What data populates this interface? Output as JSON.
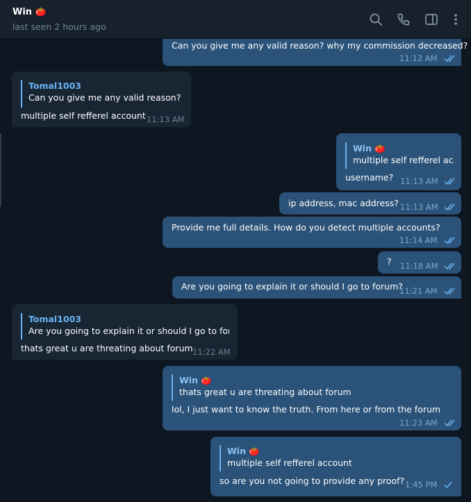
{
  "header": {
    "name": "Win 🍅",
    "status": "last seen 2 hours ago",
    "icons": [
      "search-icon",
      "phone-icon",
      "sidebar-toggle-icon",
      "more-vert-icon"
    ]
  },
  "colors": {
    "background": "#0e1621",
    "header": "#17212b",
    "outgoing_bubble": "#2b5278",
    "incoming_bubble": "#182533",
    "accent": "#6ab3f3"
  },
  "messages": [
    {
      "direction": "out",
      "text": "Can you give me any valid reason? why my commission decreased?",
      "time": "11:12 AM",
      "status": "read"
    },
    {
      "direction": "in",
      "reply": {
        "name": "Tomal1003",
        "text": "Can you give me any valid reason? ..."
      },
      "text": "multiple self refferel account",
      "time": "11:13 AM"
    },
    {
      "direction": "out",
      "reply": {
        "name": "Win 🍅",
        "text": "multiple self refferel ac..."
      },
      "text": "username?",
      "time": "11:13 AM",
      "status": "read"
    },
    {
      "direction": "out",
      "text": "ip address, mac address?",
      "time": "11:13 AM",
      "status": "read"
    },
    {
      "direction": "out",
      "text": "Provide me full details. How do you detect multiple accounts?",
      "time": "11:14 AM",
      "status": "read"
    },
    {
      "direction": "out",
      "text": "?",
      "time": "11:18 AM",
      "status": "read"
    },
    {
      "direction": "out",
      "text": "Are you going to explain it or should I go to forum?",
      "time": "11:21 AM",
      "status": "read"
    },
    {
      "direction": "in",
      "reply": {
        "name": "Tomal1003",
        "text": "Are you going to explain it or should I go to for..."
      },
      "text": "thats great u are threating about forum",
      "time": "11:22 AM"
    },
    {
      "direction": "out",
      "reply": {
        "name": "Win 🍅",
        "text": "thats great u are threating about forum"
      },
      "text": "lol, I just want to know the truth. From here or from the forum",
      "time": "11:23 AM",
      "status": "read"
    },
    {
      "direction": "out",
      "reply": {
        "name": "Win 🍅",
        "text": "multiple self refferel account"
      },
      "text": "so are you not going to provide any proof?",
      "time": "1:45 PM",
      "status": "sent"
    }
  ]
}
